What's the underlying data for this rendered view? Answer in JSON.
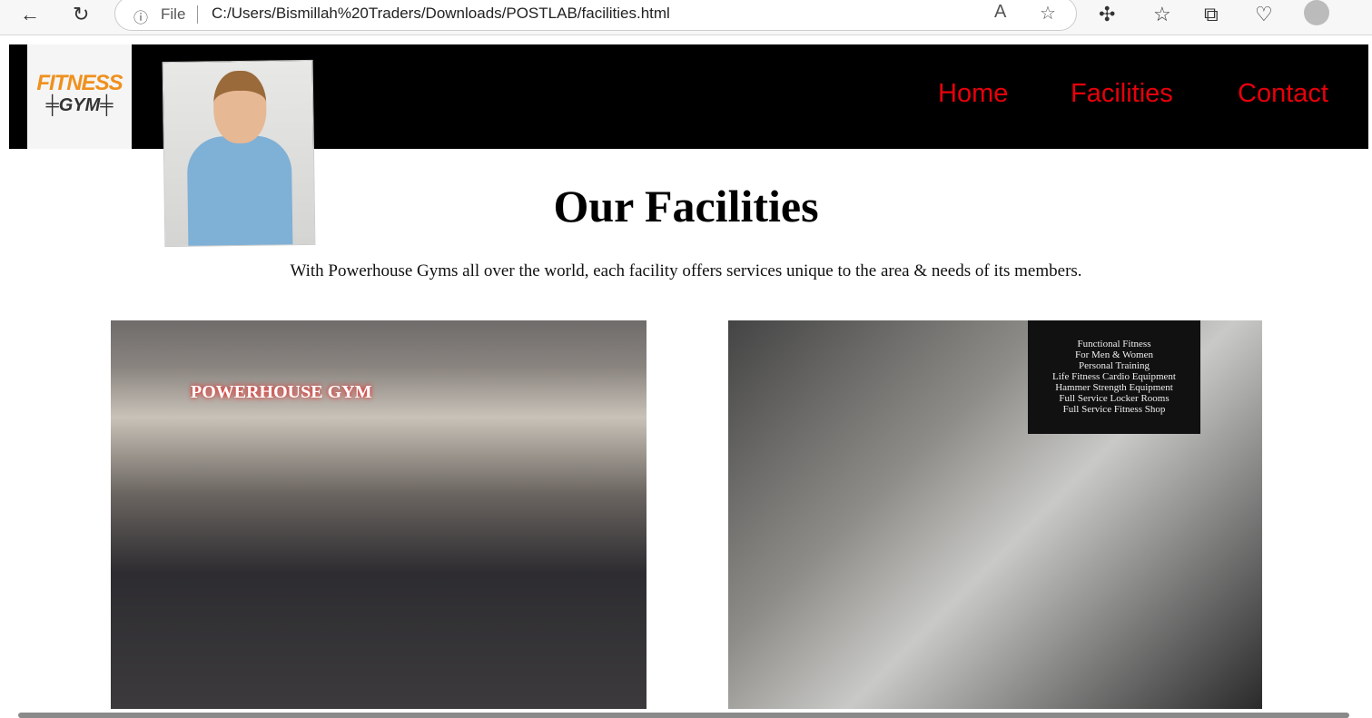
{
  "browser": {
    "url": "C:/Users/Bismillah%20Traders/Downloads/POSTLAB/facilities.html",
    "scheme_label": "File"
  },
  "logo": {
    "line1": "FITNESS",
    "line2": "GYM"
  },
  "nav": [
    {
      "label": "Home"
    },
    {
      "label": "Facilities"
    },
    {
      "label": "Contact"
    }
  ],
  "main": {
    "title": "Our Facilities",
    "description": "With Powerhouse Gyms all over the world, each facility offers services unique to the area & needs of its members."
  },
  "images": {
    "gym_sign": "POWERHOUSE GYM",
    "zone_sign": [
      "Functional Fitness",
      "For Men & Women",
      "Personal Training",
      "Life Fitness Cardio Equipment",
      "Hammer Strength Equipment",
      "Full Service Locker Rooms",
      "Full Service Fitness Shop"
    ]
  },
  "colors": {
    "nav_link": "#e8000b",
    "header_bg": "#000000",
    "logo_orange": "#f0901c"
  }
}
